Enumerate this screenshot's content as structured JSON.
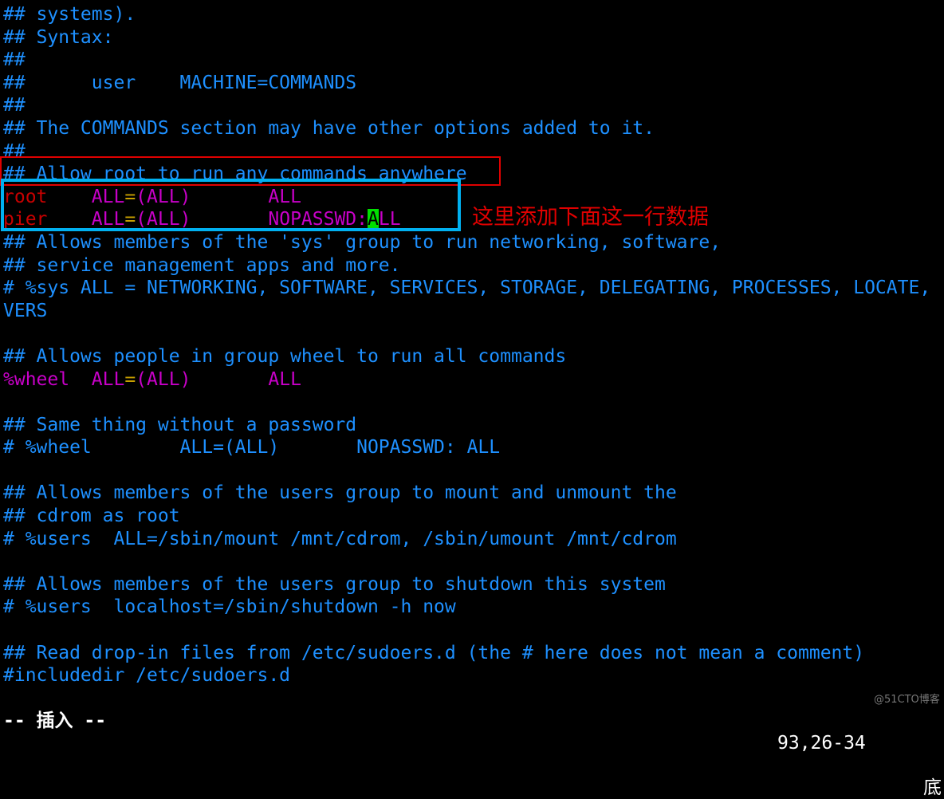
{
  "colors": {
    "comment": "#1e90ff",
    "user": "#c80000",
    "keyword": "#c800c8",
    "op": "#c8a000",
    "white": "#ffffff",
    "cursor": "#00e000",
    "annotation": "#e00000",
    "box_red": "#e00000",
    "box_cyan": "#00b0f0"
  },
  "lines": [
    [
      {
        "t": "## systems).",
        "c": "comment"
      }
    ],
    [
      {
        "t": "## Syntax:",
        "c": "comment"
      }
    ],
    [
      {
        "t": "##",
        "c": "comment"
      }
    ],
    [
      {
        "t": "##      user    MACHINE=COMMANDS",
        "c": "comment"
      }
    ],
    [
      {
        "t": "##",
        "c": "comment"
      }
    ],
    [
      {
        "t": "## The COMMANDS section may have other options added to it.",
        "c": "comment"
      }
    ],
    [
      {
        "t": "##",
        "c": "comment"
      }
    ],
    [
      {
        "t": "## Allow root to run any commands anywhere",
        "c": "comment"
      }
    ],
    [
      {
        "t": "root",
        "c": "user"
      },
      {
        "t": "    ",
        "c": "white"
      },
      {
        "t": "ALL",
        "c": "keyword"
      },
      {
        "t": "=",
        "c": "op"
      },
      {
        "t": "(ALL)",
        "c": "keyword"
      },
      {
        "t": "       ",
        "c": "white"
      },
      {
        "t": "ALL",
        "c": "keyword"
      }
    ],
    [
      {
        "t": "pier",
        "c": "user"
      },
      {
        "t": "    ",
        "c": "white"
      },
      {
        "t": "ALL",
        "c": "keyword"
      },
      {
        "t": "=",
        "c": "op"
      },
      {
        "t": "(ALL)",
        "c": "keyword"
      },
      {
        "t": "       ",
        "c": "white"
      },
      {
        "t": "NOPASSWD:",
        "c": "keyword"
      },
      {
        "t": "A",
        "c": "cursor"
      },
      {
        "t": "LL",
        "c": "keyword"
      }
    ],
    [
      {
        "t": "## Allows members of the 'sys' group to run networking, software,",
        "c": "comment"
      }
    ],
    [
      {
        "t": "## service management apps and more.",
        "c": "comment"
      }
    ],
    [
      {
        "t": "# %sys ALL = NETWORKING, SOFTWARE, SERVICES, STORAGE, DELEGATING, PROCESSES, LOCATE,",
        "c": "comment"
      }
    ],
    [
      {
        "t": "VERS",
        "c": "comment"
      }
    ],
    [],
    [
      {
        "t": "## Allows people in group wheel to run all commands",
        "c": "comment"
      }
    ],
    [
      {
        "t": "%wheel",
        "c": "keyword"
      },
      {
        "t": "  ",
        "c": "white"
      },
      {
        "t": "ALL",
        "c": "keyword"
      },
      {
        "t": "=",
        "c": "op"
      },
      {
        "t": "(ALL)",
        "c": "keyword"
      },
      {
        "t": "       ",
        "c": "white"
      },
      {
        "t": "ALL",
        "c": "keyword"
      }
    ],
    [],
    [
      {
        "t": "## Same thing without a password",
        "c": "comment"
      }
    ],
    [
      {
        "t": "# %wheel        ALL=(ALL)       NOPASSWD: ALL",
        "c": "comment"
      }
    ],
    [],
    [
      {
        "t": "## Allows members of the users group to mount and unmount the",
        "c": "comment"
      }
    ],
    [
      {
        "t": "## cdrom as root",
        "c": "comment"
      }
    ],
    [
      {
        "t": "# %users  ALL=/sbin/mount /mnt/cdrom, /sbin/umount /mnt/cdrom",
        "c": "comment"
      }
    ],
    [],
    [
      {
        "t": "## Allows members of the users group to shutdown this system",
        "c": "comment"
      }
    ],
    [
      {
        "t": "# %users  localhost=/sbin/shutdown -h now",
        "c": "comment"
      }
    ],
    [],
    [
      {
        "t": "## Read drop-in files from /etc/sudoers.d (the # here does not mean a comment)",
        "c": "comment"
      }
    ],
    [
      {
        "t": "#includedir /etc/sudoers.d",
        "c": "comment"
      }
    ]
  ],
  "annotation": "这里添加下面这一行数据",
  "status": {
    "mode": "-- 插入 --",
    "position": "93,26-34",
    "scroll": "底",
    "watermark": "@51CTO博客"
  }
}
